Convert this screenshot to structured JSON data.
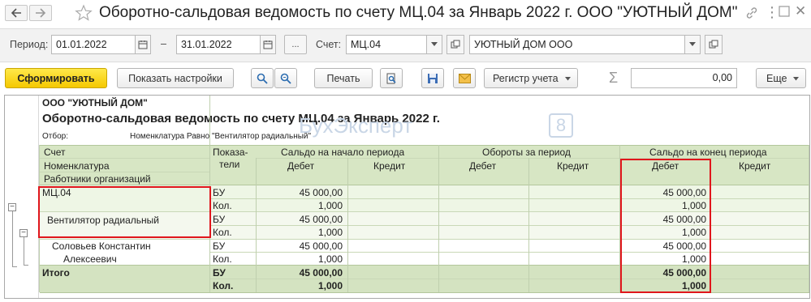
{
  "window": {
    "title": "Оборотно-сальдовая ведомость по счету МЦ.04 за Январь 2022 г. ООО \"УЮТНЫЙ ДОМ\""
  },
  "params": {
    "period_label": "Период:",
    "date_from": "01.01.2022",
    "dash": "–",
    "date_to": "31.01.2022",
    "dots": "...",
    "account_label": "Счет:",
    "account_value": "МЦ.04",
    "org_value": "УЮТНЫЙ ДОМ ООО"
  },
  "toolbar": {
    "generate_label": "Сформировать",
    "show_settings_label": "Показать настройки",
    "print_label": "Печать",
    "register_label": "Регистр учета",
    "sigma": "Σ",
    "sum_value": "0,00",
    "more_label": "Еще"
  },
  "report": {
    "org_name": "ООО \"УЮТНЫЙ ДОМ\"",
    "heading": "Оборотно-сальдовая ведомость по счету МЦ.04 за Январь 2022 г.",
    "filter_label": "Отбор:",
    "filter_value": "Номенклатура Равно \"Вентилятор радиальный\"",
    "columns": {
      "account": "Счет",
      "nomenclature": "Номенклатура",
      "employees": "Работники организаций",
      "indicators_line1": "Показа-",
      "indicators_line2": "тели",
      "opening": "Сальдо на начало периода",
      "turnover": "Обороты за период",
      "closing": "Сальдо на конец периода",
      "debit": "Дебет",
      "credit": "Кредит"
    },
    "rows": [
      {
        "name": "МЦ.04",
        "ind": "БУ",
        "open_debit": "45 000,00",
        "close_debit": "45 000,00"
      },
      {
        "name": "",
        "ind": "Кол.",
        "open_debit": "1,000",
        "close_debit": "1,000"
      },
      {
        "name": "Вентилятор радиальный",
        "ind": "БУ",
        "open_debit": "45 000,00",
        "close_debit": "45 000,00"
      },
      {
        "name": "",
        "ind": "Кол.",
        "open_debit": "1,000",
        "close_debit": "1,000"
      },
      {
        "name": "Соловьев Константин",
        "ind": "БУ",
        "open_debit": "45 000,00",
        "close_debit": "45 000,00"
      },
      {
        "name": "Алексеевич",
        "ind": "Кол.",
        "open_debit": "1,000",
        "close_debit": "1,000"
      }
    ],
    "total": {
      "label": "Итого",
      "ind_bu": "БУ",
      "ind_qty": "Кол.",
      "open_debit_bu": "45 000,00",
      "open_debit_qty": "1,000",
      "close_debit_bu": "45 000,00",
      "close_debit_qty": "1,000"
    },
    "watermark_title": "БухЭксперт",
    "watermark_num": "8",
    "watermark_sub": "База ответов по учёту в 1С"
  },
  "colors": {
    "header_green": "#d7e6c4",
    "row_light": "#eef6e5",
    "total_green": "#d4e3c1",
    "highlight_red": "#e0161c",
    "primary_yellow": "#f5c800"
  }
}
